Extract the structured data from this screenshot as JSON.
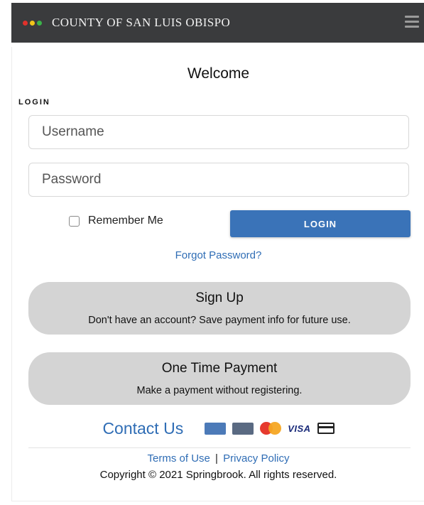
{
  "header": {
    "title": "COUNTY OF SAN LUIS OBISPO",
    "dots": [
      "#e0312b",
      "#f0c419",
      "#3bb34a"
    ]
  },
  "main": {
    "welcome": "Welcome",
    "login_section_label": "LOGIN",
    "username_placeholder": "Username",
    "password_placeholder": "Password",
    "remember_label": "Remember Me",
    "remember_checked": false,
    "login_button": "LOGIN",
    "forgot_link": "Forgot Password?",
    "signup": {
      "title": "Sign Up",
      "subtitle": "Don't have an account? Save payment info for future use."
    },
    "one_time": {
      "title": "One Time Payment",
      "subtitle": "Make a payment without registering."
    }
  },
  "footer": {
    "contact_link": "Contact Us",
    "payment_icons": [
      "amex-card-icon",
      "discover-card-icon",
      "mastercard-icon",
      "visa-icon",
      "generic-card-icon"
    ],
    "visa_text": "VISA",
    "terms_link": "Terms of Use",
    "separator": "|",
    "privacy_link": "Privacy Policy",
    "copyright": "Copyright © 2021 Springbrook. All rights reserved."
  },
  "colors": {
    "accent": "#3a73b8",
    "link": "#2f6db5",
    "header_bg": "#3a3b3d",
    "card_bg": "#d4d4d4"
  }
}
